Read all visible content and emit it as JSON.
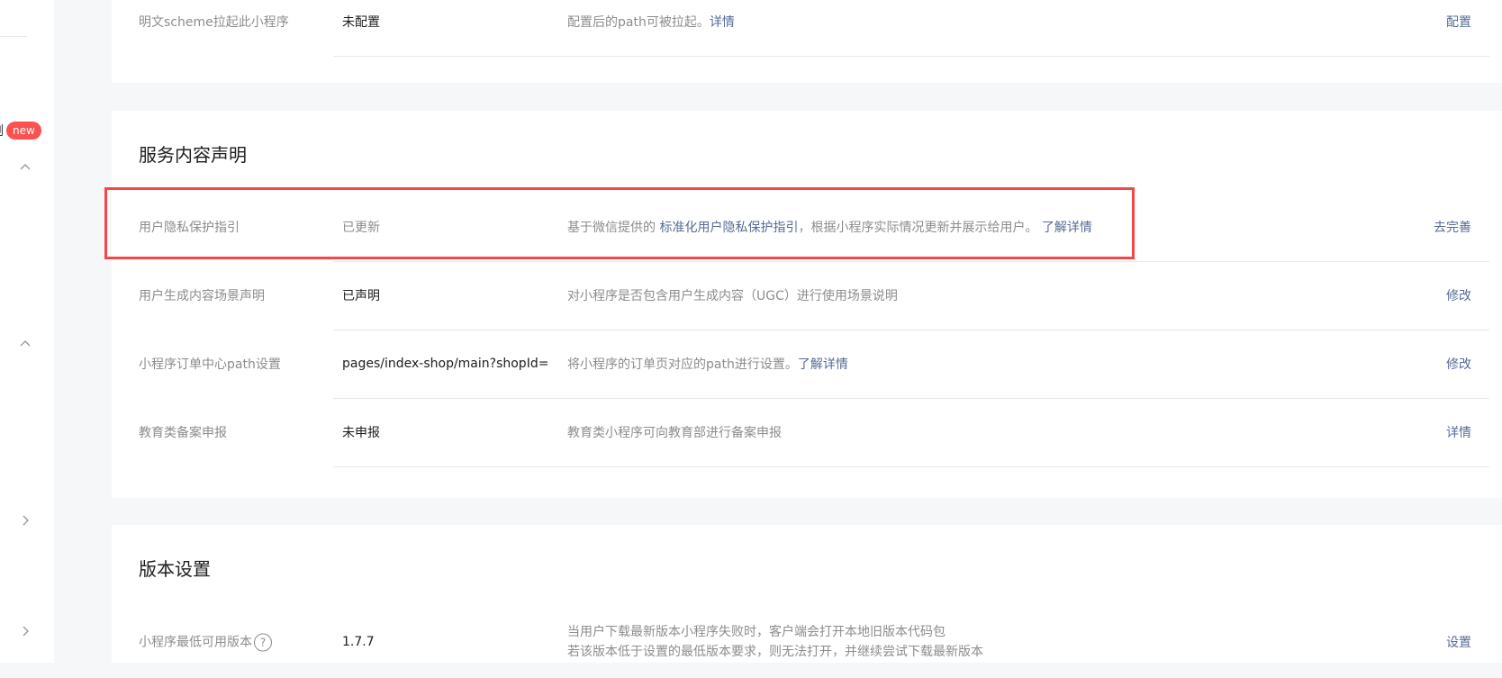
{
  "sidebar": {
    "clipped_char": "例",
    "new_badge": "new",
    "icons": [
      "chevron-up-icon",
      "chevron-up-icon",
      "chevron-right-icon",
      "chevron-right-icon"
    ]
  },
  "card1": {
    "row": {
      "label": "明文scheme拉起此小程序",
      "value": "未配置",
      "desc": "配置后的path可被拉起。",
      "desc_link": "详情",
      "action": "配置"
    }
  },
  "service_section": {
    "title": "服务内容声明",
    "rows": [
      {
        "label": "用户隐私保护指引",
        "value": "已更新",
        "desc_prefix": "基于微信提供的 ",
        "desc_link": "标准化用户隐私保护指引",
        "desc_suffix": "，根据小程序实际情况更新并展示给用户。 ",
        "desc_link2": "了解详情",
        "action": "去完善"
      },
      {
        "label": "用户生成内容场景声明",
        "value": "已声明",
        "desc": "对小程序是否包含用户生成内容（UGC）进行使用场景说明",
        "action": "修改"
      },
      {
        "label": "小程序订单中心path设置",
        "value": "pages/index-shop/main?shopId=",
        "desc": "将小程序的订单页对应的path进行设置。",
        "desc_link": "了解详情",
        "action": "修改"
      },
      {
        "label": "教育类备案申报",
        "value": "未申报",
        "desc": "教育类小程序可向教育部进行备案申报",
        "action": "详情"
      }
    ]
  },
  "version_section": {
    "title": "版本设置",
    "row": {
      "label": "小程序最低可用版本",
      "help_icon": "?",
      "value": "1.7.7",
      "desc_line1": "当用户下载最新版本小程序失败时，客户端会打开本地旧版本代码包",
      "desc_line2": "若该版本低于设置的最低版本要求，则无法打开，并继续尝试下载最新版本",
      "action": "设置"
    }
  },
  "colors": {
    "link": "#576b95",
    "highlight": "#f44848",
    "badge": "#fa5151",
    "background": "#f6f7f9"
  }
}
